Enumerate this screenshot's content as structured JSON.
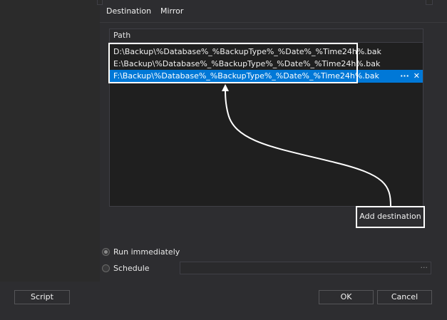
{
  "tabs": [
    {
      "label": "Destination",
      "active": true
    },
    {
      "label": "Mirror",
      "active": false
    }
  ],
  "grid": {
    "header": "Path",
    "rows": [
      {
        "path": "D:\\Backup\\%Database%_%BackupType%_%Date%_%Time24h%.bak",
        "selected": false
      },
      {
        "path": "E:\\Backup\\%Database%_%BackupType%_%Date%_%Time24h%.bak",
        "selected": false
      },
      {
        "path": "F:\\Backup\\%Database%_%BackupType%_%Date%_%Time24h%.bak",
        "selected": true
      }
    ],
    "row_actions": {
      "more": "···",
      "remove": "✕"
    }
  },
  "add_destination_label": "Add destination",
  "run_options": {
    "run_immediately_label": "Run immediately",
    "schedule_label": "Schedule",
    "schedule_value": "",
    "schedule_browse": "···",
    "selected": "run_immediately"
  },
  "footer": {
    "script_label": "Script",
    "ok_label": "OK",
    "cancel_label": "Cancel"
  },
  "colors": {
    "background": "#2d2d30",
    "grid_background": "#1f1f1f",
    "selection": "#0078d7",
    "annotation": "#ffffff"
  },
  "icons": {
    "more": "ellipsis-icon",
    "remove": "close-icon",
    "arrow": "annotation-arrow-icon"
  }
}
